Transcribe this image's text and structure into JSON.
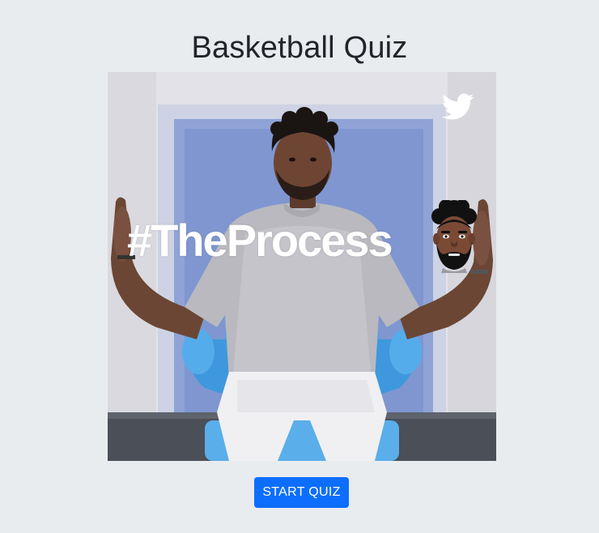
{
  "header": {
    "title": "Basketball Quiz"
  },
  "media": {
    "overlay_text": "#TheProcess",
    "icons": {
      "social": "twitter-bird-icon",
      "player_face": "player-face-emoji-icon"
    }
  },
  "actions": {
    "start_label": "START QUIZ"
  },
  "colors": {
    "background": "#e9ecef",
    "primary": "#0d6efd",
    "title_text": "#212529",
    "overlay_text": "#ffffff",
    "chair_blue": "#4aa3e6"
  }
}
